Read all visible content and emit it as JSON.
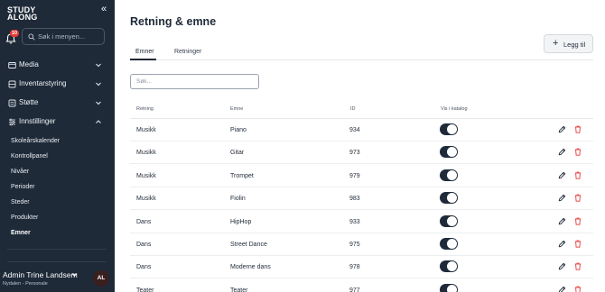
{
  "sidebar": {
    "logo_line1": "STUDY",
    "logo_line2": "ALONG",
    "collapse_glyph": "«",
    "notifications_count": "10",
    "search_placeholder": "Søk i menyen...",
    "nav": [
      {
        "label": "Media",
        "icon": "media-icon",
        "expanded": false
      },
      {
        "label": "Inventarstyring",
        "icon": "inventory-icon",
        "expanded": false
      },
      {
        "label": "Støtte",
        "icon": "support-icon",
        "expanded": false
      },
      {
        "label": "Innstillinger",
        "icon": "settings-sliders-icon",
        "expanded": true
      }
    ],
    "sub_items": [
      {
        "label": "Skoleårskalender",
        "active": false
      },
      {
        "label": "Kontrollpanel",
        "active": false
      },
      {
        "label": "Nivåer",
        "active": false
      },
      {
        "label": "Perioder",
        "active": false
      },
      {
        "label": "Steder",
        "active": false
      },
      {
        "label": "Produkter",
        "active": false
      },
      {
        "label": "Emner",
        "active": true
      }
    ],
    "user": {
      "name": "Admin Trine Landsem",
      "subtitle": "Nydalen - Personale",
      "initials": "AL"
    }
  },
  "main": {
    "title": "Retning & emne",
    "add_button": "Legg til",
    "tabs": [
      {
        "label": "Emner",
        "active": true
      },
      {
        "label": "Retninger",
        "active": false
      }
    ],
    "filter_placeholder": "Søk...",
    "columns": [
      "Retning",
      "Emne",
      "ID",
      "Vis i katalog"
    ],
    "rows": [
      {
        "retning": "Musikk",
        "emne": "Piano",
        "id": "934",
        "vis_i_katalog": true
      },
      {
        "retning": "Musikk",
        "emne": "Gitar",
        "id": "973",
        "vis_i_katalog": true
      },
      {
        "retning": "Musikk",
        "emne": "Trompet",
        "id": "979",
        "vis_i_katalog": true
      },
      {
        "retning": "Musikk",
        "emne": "Fiolin",
        "id": "983",
        "vis_i_katalog": true
      },
      {
        "retning": "Dans",
        "emne": "HipHop",
        "id": "933",
        "vis_i_katalog": true
      },
      {
        "retning": "Dans",
        "emne": "Street Dance",
        "id": "975",
        "vis_i_katalog": true
      },
      {
        "retning": "Dans",
        "emne": "Moderne dans",
        "id": "978",
        "vis_i_katalog": true
      },
      {
        "retning": "Teater",
        "emne": "Teater",
        "id": "977",
        "vis_i_katalog": true
      }
    ]
  },
  "colors": {
    "sidebar_bg": "#1e2a38",
    "toggle_on": "#1e2a38",
    "delete_icon": "#e53935",
    "badge": "#e53935"
  }
}
